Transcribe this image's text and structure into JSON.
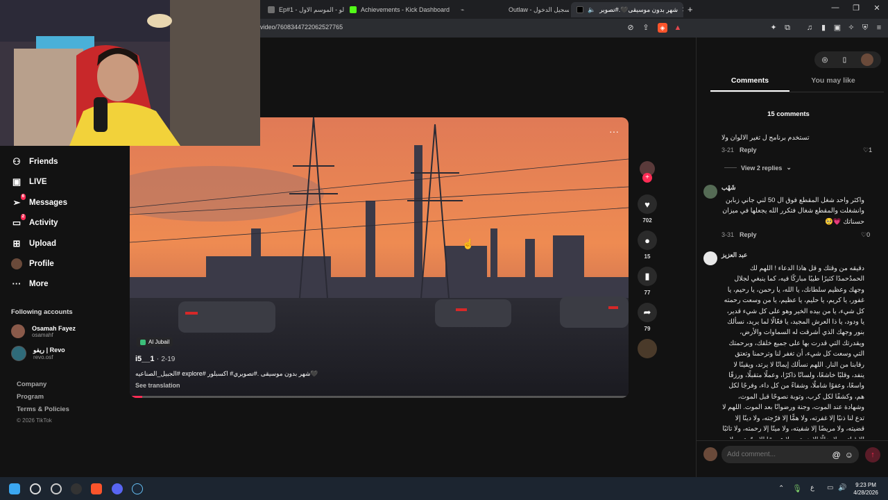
{
  "browser": {
    "tabs": [
      {
        "label": "Ep#1 - ميزكالو - الموسم الاول",
        "icon": "music-tab-icon",
        "color": "#7a7a7a"
      },
      {
        "label": "Achievements - Kick Dashboard",
        "icon": "kick-logo-icon",
        "color": "#53fc18"
      },
      {
        "label": "",
        "icon": "link-icon",
        "color": "#777"
      },
      {
        "label": "Outlaw - تسجيل الدخول",
        "icon": "outlaw-icon",
        "color": "#444"
      },
      {
        "label": "شهر بدون موسيقى🖤.#تصوير",
        "icon": "tiktok-tab-icon",
        "color": "#000"
      }
    ],
    "new_tab": "+",
    "url": "video/7608344722062527765"
  },
  "sidebar": {
    "items": [
      {
        "label": "Friends",
        "icon": "friends-icon",
        "glyph": "👥"
      },
      {
        "label": "LIVE",
        "icon": "live-icon",
        "glyph": "📺"
      },
      {
        "label": "Messages",
        "icon": "messages-icon",
        "glyph": "✈",
        "badge": "6"
      },
      {
        "label": "Activity",
        "icon": "activity-icon",
        "glyph": "💬",
        "badge": "2"
      },
      {
        "label": "Upload",
        "icon": "upload-icon",
        "glyph": "⊞"
      },
      {
        "label": "Profile",
        "icon": "profile-icon",
        "glyph": ""
      },
      {
        "label": "More",
        "icon": "more-icon",
        "glyph": "···"
      }
    ],
    "following_title": "Following accounts",
    "following": [
      {
        "name": "Osamah Fayez",
        "handle": "osamahf"
      },
      {
        "name": "ريفو | Revo",
        "handle": "revo.osf"
      }
    ],
    "footer": [
      "Company",
      "Program",
      "Terms & Policies",
      "© 2026 TikTok"
    ]
  },
  "video": {
    "location": "Al Jubail",
    "author": "i5__1",
    "date": "2-19",
    "caption": "🖤شهر بدون موسيقى .#تصويري# اكسبلور #explore #الجبيل_الصناعيه",
    "see_translation": "See translation",
    "more": "···",
    "progress": 0.025
  },
  "actions": {
    "likes": "702",
    "comments": "15",
    "saves": "77",
    "shares": "79"
  },
  "comments_panel": {
    "tabs": [
      "Comments",
      "You may like"
    ],
    "count_label": "15 comments",
    "comments": [
      {
        "text": "تستخدم برنامج ل تغير الالوان ولا",
        "date": "3-21",
        "reply": "Reply",
        "likes": "1",
        "view_replies": "View 2 replies"
      },
      {
        "user": "شَهْب",
        "text": "واكثر واحد شغل المقطع فوق ال 50 لني جاني زبابن وانشغلت والمقطع شغال فتكرر الله يجعلها في ميزان حسناتك 💗🥺",
        "date": "3-31",
        "reply": "Reply",
        "likes": "0"
      },
      {
        "user": "عبد العزيز",
        "text": "دقيقه من وقتك و قل هاذا الدعاء ! اللهم لك الحمدُحمدًا كثيرًا طيبًا مباركًا فيه، كما ينبغي لجلال وجهك وعظيم سلطانك، يا الله، يا رحمن، يا رحيم، يا غفور، يا كريم، يا حليم، يا عظيم، يا من وسعت رحمته كل شيء، يا من بيده الخير وهو على كل شيء قدير، يا ودود، يا ذا العرش المجيد، يا فعّالًا لما يريد، نسألك بنور وجهك الذي أشرقت له السماوات والأرض، ويقدرتك التي قدرت بها على جميع خلقك، وبرحمتك التي وسعت كل شيء، أن تغفر لنا وترحمنا وتعتق رقابنا من النار. اللهم نسألك إيمانًا لا يرتد، ويقينًا لا ينفد، وقلبًا خاشعًا، ولسانًا ذاكرًا، وعملًا متقبلًا، ورزقًا واسعًا، وعفوًا شاملًا، وشفاءً من كل داء، وفرجًا لكل هم، وكشفًا لكل كرب، وتوبة نصوحًا قبل الموت، وشهادة عند الموت، وجنة ورضوانًا بعد الموت. اللهم لا تدع لنا ذنبًا إلا غفرته، ولا همًّا إلا فرّجته، ولا دينًا إلا قضيته، ولا مريضًا إلا شفيته، ولا ميتًا إلا رحمته، ولا تائبًا إلا قبلته، ولا ضالًا إلا هديته، ولا عسيرًا إلا يسّرته، ولا حاجة من حوائج الدنيا والآخرة هي لك رضى ولنا فيها"
      }
    ],
    "add_comment_placeholder": "Add comment..."
  },
  "taskbar": {
    "time": "9:23 PM",
    "date": "4/28/2026",
    "lang": "ع"
  },
  "colors": {
    "accent": "#fe2c55",
    "bg": "#121212"
  }
}
